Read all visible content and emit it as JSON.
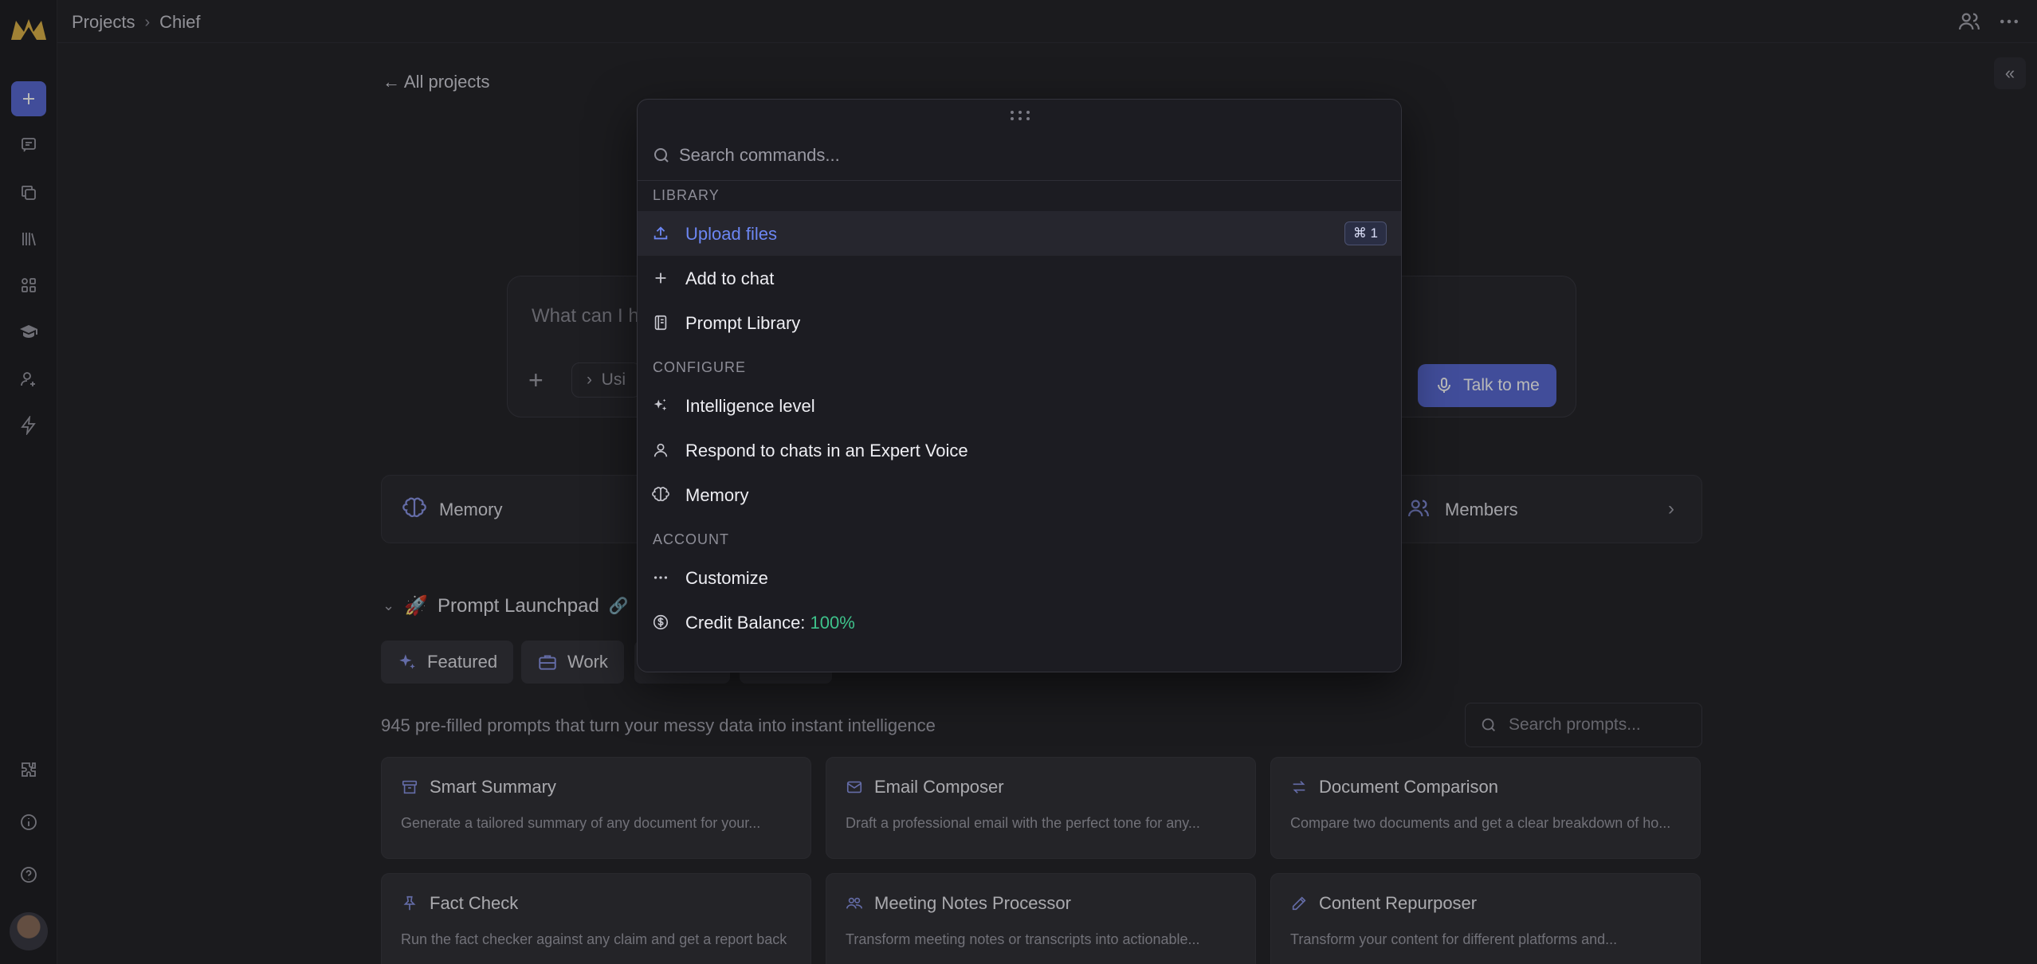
{
  "breadcrumb": {
    "root": "Projects",
    "current": "Chief"
  },
  "back_link": "All projects",
  "chat": {
    "placeholder": "What can I h",
    "using_label": "Usi",
    "talk_button": "Talk to me"
  },
  "cards": {
    "memory": "Memory",
    "members": "Members"
  },
  "launchpad": {
    "title": "Prompt Launchpad",
    "tabs": [
      "Featured",
      "Work"
    ],
    "count_text": "945 pre-filled prompts that turn your messy data into instant intelligence",
    "search_placeholder": "Search prompts...",
    "prompts": [
      {
        "title": "Smart Summary",
        "desc": "Generate a tailored summary of any document for your...",
        "icon": "archive-icon"
      },
      {
        "title": "Email Composer",
        "desc": "Draft a professional email with the perfect tone for any...",
        "icon": "mail-icon"
      },
      {
        "title": "Document Comparison",
        "desc": "Compare two documents and get a clear breakdown of ho...",
        "icon": "swap-icon"
      },
      {
        "title": "Fact Check",
        "desc": "Run the fact checker against any claim and get a report back",
        "icon": "pin-icon"
      },
      {
        "title": "Meeting Notes Processor",
        "desc": "Transform meeting notes or transcripts into actionable...",
        "icon": "people-icon"
      },
      {
        "title": "Content Repurposer",
        "desc": "Transform your content for different platforms and...",
        "icon": "pencil-icon"
      }
    ]
  },
  "palette": {
    "search_placeholder": "Search commands...",
    "sections": {
      "library": "LIBRARY",
      "configure": "CONFIGURE",
      "account": "ACCOUNT"
    },
    "commands": {
      "upload_files": "Upload files",
      "upload_shortcut": "⌘ 1",
      "add_to_chat": "Add to chat",
      "prompt_library": "Prompt Library",
      "intelligence_level": "Intelligence level",
      "expert_voice": "Respond to chats in an Expert Voice",
      "memory": "Memory",
      "customize": "Customize",
      "credit_label": "Credit Balance: ",
      "credit_value": "100%"
    }
  },
  "colors": {
    "accent": "#5a6bd6",
    "active_text": "#6c86f2",
    "credit_green": "#3ec28b",
    "logo_gold": "#e0b54a"
  }
}
